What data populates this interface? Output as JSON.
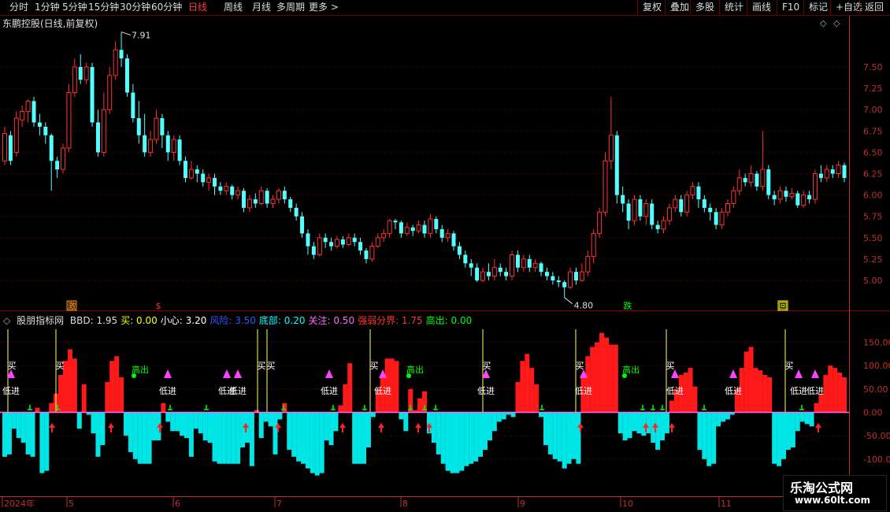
{
  "toolbar": {
    "left_items": [
      "分时",
      "1分钟",
      "5分钟",
      "15分钟",
      "30分钟",
      "60分钟",
      "日线",
      "周线",
      "月线",
      "多周期",
      "更多 >"
    ],
    "active": "日线",
    "right_items": [
      "复权",
      "叠加",
      "多股",
      "统计",
      "画线",
      "F10",
      "标记",
      "+自选",
      "返回"
    ]
  },
  "main_title": "东鹏控股(日线,前复权)",
  "indicator": {
    "name": "股朋指标网",
    "legend": [
      {
        "label": "BBD: 1.95",
        "color": "#dddddd"
      },
      {
        "label": "买: 0.00",
        "color": "#ffff00"
      },
      {
        "label": "小心: 3.20",
        "color": "#ffffff"
      },
      {
        "label": "风险: 3.50",
        "color": "#3355ff"
      },
      {
        "label": "底部: 0.20",
        "color": "#00ffff"
      },
      {
        "label": "关注: 0.50",
        "color": "#ff66ff"
      },
      {
        "label": "强弱分界: 1.75",
        "color": "#ff3333"
      },
      {
        "label": "高出: 0.00",
        "color": "#00ff00"
      }
    ]
  },
  "colors": {
    "up": "#ff3232",
    "down": "#54ffff",
    "grid": "#6b0000",
    "axis": "#c0302a",
    "pos_bar": "#ff1a1a",
    "neg_bar": "#00e5e5"
  },
  "chart_data": [
    {
      "type": "candlestick",
      "title": "东鹏控股(日线,前复权)",
      "y_ticks": [
        5.0,
        5.25,
        5.5,
        5.75,
        6.0,
        6.25,
        6.5,
        6.75,
        7.0,
        7.25,
        7.5
      ],
      "ylim": [
        4.85,
        7.95
      ],
      "annotations": [
        {
          "text": "7.91",
          "kind": "high"
        },
        {
          "text": "4.80",
          "kind": "low"
        }
      ],
      "event_markers": [
        "激",
        "$",
        "跌",
        "回"
      ],
      "candles": [
        {
          "o": 6.4,
          "c": 6.72,
          "h": 6.8,
          "l": 6.35
        },
        {
          "o": 6.7,
          "c": 6.4,
          "h": 6.75,
          "l": 6.35
        },
        {
          "o": 6.5,
          "c": 6.9,
          "h": 6.98,
          "l": 6.45
        },
        {
          "o": 6.88,
          "c": 6.98,
          "h": 7.05,
          "l": 6.8
        },
        {
          "o": 6.98,
          "c": 7.1,
          "h": 7.12,
          "l": 6.85
        },
        {
          "o": 7.1,
          "c": 6.85,
          "h": 7.15,
          "l": 6.8
        },
        {
          "o": 6.85,
          "c": 6.8,
          "h": 6.95,
          "l": 6.7
        },
        {
          "o": 6.8,
          "c": 6.7,
          "h": 6.85,
          "l": 6.6
        },
        {
          "o": 6.7,
          "c": 6.4,
          "h": 6.72,
          "l": 6.05
        },
        {
          "o": 6.4,
          "c": 6.3,
          "h": 6.45,
          "l": 6.2
        },
        {
          "o": 6.3,
          "c": 6.55,
          "h": 6.6,
          "l": 6.25
        },
        {
          "o": 6.55,
          "c": 7.2,
          "h": 7.3,
          "l": 6.5
        },
        {
          "o": 7.2,
          "c": 7.5,
          "h": 7.6,
          "l": 7.15
        },
        {
          "o": 7.5,
          "c": 7.35,
          "h": 7.65,
          "l": 7.3
        },
        {
          "o": 7.35,
          "c": 7.5,
          "h": 7.55,
          "l": 7.3
        },
        {
          "o": 7.5,
          "c": 6.85,
          "h": 7.55,
          "l": 6.8
        },
        {
          "o": 6.85,
          "c": 6.5,
          "h": 7.0,
          "l": 6.45
        },
        {
          "o": 6.5,
          "c": 7.0,
          "h": 7.2,
          "l": 6.45
        },
        {
          "o": 7.0,
          "c": 7.4,
          "h": 7.5,
          "l": 6.95
        },
        {
          "o": 7.4,
          "c": 7.7,
          "h": 7.8,
          "l": 7.35
        },
        {
          "o": 7.7,
          "c": 7.6,
          "h": 7.91,
          "l": 7.5
        },
        {
          "o": 7.6,
          "c": 7.2,
          "h": 7.65,
          "l": 7.15
        },
        {
          "o": 7.2,
          "c": 6.9,
          "h": 7.3,
          "l": 6.85
        },
        {
          "o": 6.9,
          "c": 6.7,
          "h": 7.1,
          "l": 6.6
        },
        {
          "o": 6.7,
          "c": 6.5,
          "h": 6.95,
          "l": 6.45
        },
        {
          "o": 6.5,
          "c": 6.65,
          "h": 6.75,
          "l": 6.45
        },
        {
          "o": 6.65,
          "c": 6.9,
          "h": 7.0,
          "l": 6.6
        },
        {
          "o": 6.9,
          "c": 6.7,
          "h": 6.95,
          "l": 6.55
        },
        {
          "o": 6.7,
          "c": 6.5,
          "h": 6.75,
          "l": 6.4
        },
        {
          "o": 6.5,
          "c": 6.65,
          "h": 6.7,
          "l": 6.4
        },
        {
          "o": 6.65,
          "c": 6.4,
          "h": 6.7,
          "l": 6.35
        },
        {
          "o": 6.4,
          "c": 6.2,
          "h": 6.45,
          "l": 6.15
        },
        {
          "o": 6.2,
          "c": 6.3,
          "h": 6.4,
          "l": 6.18
        },
        {
          "o": 6.3,
          "c": 6.25,
          "h": 6.35,
          "l": 6.15
        },
        {
          "o": 6.25,
          "c": 6.15,
          "h": 6.3,
          "l": 6.1
        },
        {
          "o": 6.15,
          "c": 6.2,
          "h": 6.25,
          "l": 6.05
        },
        {
          "o": 6.2,
          "c": 6.1,
          "h": 6.25,
          "l": 6.0
        },
        {
          "o": 6.1,
          "c": 6.05,
          "h": 6.15,
          "l": 6.0
        },
        {
          "o": 6.05,
          "c": 6.1,
          "h": 6.15,
          "l": 6.0
        },
        {
          "o": 6.1,
          "c": 6.0,
          "h": 6.12,
          "l": 5.95
        },
        {
          "o": 6.0,
          "c": 6.05,
          "h": 6.1,
          "l": 5.95
        },
        {
          "o": 6.05,
          "c": 5.85,
          "h": 6.08,
          "l": 5.8
        },
        {
          "o": 5.85,
          "c": 5.95,
          "h": 6.0,
          "l": 5.8
        },
        {
          "o": 5.95,
          "c": 5.9,
          "h": 6.02,
          "l": 5.85
        },
        {
          "o": 5.9,
          "c": 6.05,
          "h": 6.1,
          "l": 5.88
        },
        {
          "o": 6.05,
          "c": 5.9,
          "h": 6.08,
          "l": 5.85
        },
        {
          "o": 5.9,
          "c": 5.95,
          "h": 6.0,
          "l": 5.85
        },
        {
          "o": 5.95,
          "c": 6.05,
          "h": 6.08,
          "l": 5.9
        },
        {
          "o": 6.05,
          "c": 5.95,
          "h": 6.1,
          "l": 5.9
        },
        {
          "o": 5.95,
          "c": 5.85,
          "h": 5.98,
          "l": 5.8
        },
        {
          "o": 5.85,
          "c": 5.75,
          "h": 5.9,
          "l": 5.7
        },
        {
          "o": 5.75,
          "c": 5.55,
          "h": 5.8,
          "l": 5.5
        },
        {
          "o": 5.55,
          "c": 5.4,
          "h": 5.6,
          "l": 5.3
        },
        {
          "o": 5.4,
          "c": 5.3,
          "h": 5.45,
          "l": 5.25
        },
        {
          "o": 5.3,
          "c": 5.5,
          "h": 5.55,
          "l": 5.28
        },
        {
          "o": 5.5,
          "c": 5.45,
          "h": 5.55,
          "l": 5.38
        },
        {
          "o": 5.45,
          "c": 5.4,
          "h": 5.5,
          "l": 5.35
        },
        {
          "o": 5.4,
          "c": 5.48,
          "h": 5.52,
          "l": 5.38
        },
        {
          "o": 5.48,
          "c": 5.42,
          "h": 5.52,
          "l": 5.38
        },
        {
          "o": 5.42,
          "c": 5.5,
          "h": 5.55,
          "l": 5.4
        },
        {
          "o": 5.5,
          "c": 5.45,
          "h": 5.55,
          "l": 5.4
        },
        {
          "o": 5.45,
          "c": 5.35,
          "h": 5.5,
          "l": 5.3
        },
        {
          "o": 5.35,
          "c": 5.25,
          "h": 5.38,
          "l": 5.2
        },
        {
          "o": 5.25,
          "c": 5.4,
          "h": 5.45,
          "l": 5.22
        },
        {
          "o": 5.4,
          "c": 5.5,
          "h": 5.55,
          "l": 5.38
        },
        {
          "o": 5.5,
          "c": 5.55,
          "h": 5.6,
          "l": 5.45
        },
        {
          "o": 5.55,
          "c": 5.7,
          "h": 5.72,
          "l": 5.5
        },
        {
          "o": 5.7,
          "c": 5.68,
          "h": 5.72,
          "l": 5.6
        },
        {
          "o": 5.68,
          "c": 5.55,
          "h": 5.7,
          "l": 5.5
        },
        {
          "o": 5.55,
          "c": 5.62,
          "h": 5.68,
          "l": 5.52
        },
        {
          "o": 5.62,
          "c": 5.58,
          "h": 5.65,
          "l": 5.52
        },
        {
          "o": 5.58,
          "c": 5.65,
          "h": 5.7,
          "l": 5.55
        },
        {
          "o": 5.65,
          "c": 5.55,
          "h": 5.7,
          "l": 5.5
        },
        {
          "o": 5.55,
          "c": 5.72,
          "h": 5.78,
          "l": 5.5
        },
        {
          "o": 5.72,
          "c": 5.6,
          "h": 5.75,
          "l": 5.55
        },
        {
          "o": 5.6,
          "c": 5.5,
          "h": 5.65,
          "l": 5.45
        },
        {
          "o": 5.5,
          "c": 5.55,
          "h": 5.6,
          "l": 5.45
        },
        {
          "o": 5.55,
          "c": 5.4,
          "h": 5.58,
          "l": 5.35
        },
        {
          "o": 5.4,
          "c": 5.3,
          "h": 5.45,
          "l": 5.25
        },
        {
          "o": 5.3,
          "c": 5.2,
          "h": 5.35,
          "l": 5.15
        },
        {
          "o": 5.2,
          "c": 5.15,
          "h": 5.25,
          "l": 5.05
        },
        {
          "o": 5.15,
          "c": 5.0,
          "h": 5.2,
          "l": 4.98
        },
        {
          "o": 5.0,
          "c": 5.1,
          "h": 5.15,
          "l": 4.98
        },
        {
          "o": 5.1,
          "c": 5.05,
          "h": 5.2,
          "l": 5.0
        },
        {
          "o": 5.05,
          "c": 5.15,
          "h": 5.25,
          "l": 5.0
        },
        {
          "o": 5.15,
          "c": 5.1,
          "h": 5.2,
          "l": 5.05
        },
        {
          "o": 5.1,
          "c": 5.05,
          "h": 5.15,
          "l": 5.0
        },
        {
          "o": 5.05,
          "c": 5.3,
          "h": 5.35,
          "l": 5.0
        },
        {
          "o": 5.3,
          "c": 5.15,
          "h": 5.35,
          "l": 5.1
        },
        {
          "o": 5.15,
          "c": 5.25,
          "h": 5.3,
          "l": 5.1
        },
        {
          "o": 5.25,
          "c": 5.15,
          "h": 5.3,
          "l": 5.1
        },
        {
          "o": 5.15,
          "c": 5.2,
          "h": 5.25,
          "l": 5.1
        },
        {
          "o": 5.2,
          "c": 5.1,
          "h": 5.22,
          "l": 5.05
        },
        {
          "o": 5.1,
          "c": 5.05,
          "h": 5.15,
          "l": 5.0
        },
        {
          "o": 5.05,
          "c": 5.0,
          "h": 5.1,
          "l": 4.95
        },
        {
          "o": 5.0,
          "c": 4.98,
          "h": 5.05,
          "l": 4.92
        },
        {
          "o": 4.98,
          "c": 4.92,
          "h": 5.0,
          "l": 4.8
        },
        {
          "o": 4.92,
          "c": 5.1,
          "h": 5.15,
          "l": 4.9
        },
        {
          "o": 5.1,
          "c": 5.0,
          "h": 5.15,
          "l": 4.95
        },
        {
          "o": 5.0,
          "c": 5.1,
          "h": 5.2,
          "l": 4.98
        },
        {
          "o": 5.1,
          "c": 5.28,
          "h": 5.35,
          "l": 5.05
        },
        {
          "o": 5.28,
          "c": 5.55,
          "h": 5.6,
          "l": 5.2
        },
        {
          "o": 5.55,
          "c": 5.8,
          "h": 5.85,
          "l": 5.5
        },
        {
          "o": 5.8,
          "c": 6.4,
          "h": 6.5,
          "l": 5.75
        },
        {
          "o": 6.4,
          "c": 6.7,
          "h": 7.15,
          "l": 6.3
        },
        {
          "o": 6.7,
          "c": 6.0,
          "h": 6.75,
          "l": 5.9
        },
        {
          "o": 6.0,
          "c": 5.9,
          "h": 6.1,
          "l": 5.8
        },
        {
          "o": 5.9,
          "c": 5.7,
          "h": 5.95,
          "l": 5.6
        },
        {
          "o": 5.7,
          "c": 5.95,
          "h": 6.0,
          "l": 5.65
        },
        {
          "o": 5.95,
          "c": 5.75,
          "h": 6.0,
          "l": 5.7
        },
        {
          "o": 5.75,
          "c": 5.9,
          "h": 5.95,
          "l": 5.65
        },
        {
          "o": 5.9,
          "c": 5.65,
          "h": 5.95,
          "l": 5.6
        },
        {
          "o": 5.65,
          "c": 5.6,
          "h": 5.7,
          "l": 5.55
        },
        {
          "o": 5.6,
          "c": 5.7,
          "h": 5.75,
          "l": 5.55
        },
        {
          "o": 5.7,
          "c": 5.85,
          "h": 5.9,
          "l": 5.65
        },
        {
          "o": 5.85,
          "c": 5.95,
          "h": 6.0,
          "l": 5.8
        },
        {
          "o": 5.95,
          "c": 5.8,
          "h": 6.0,
          "l": 5.75
        },
        {
          "o": 5.8,
          "c": 6.0,
          "h": 6.05,
          "l": 5.75
        },
        {
          "o": 6.0,
          "c": 6.1,
          "h": 6.15,
          "l": 5.95
        },
        {
          "o": 6.1,
          "c": 5.95,
          "h": 6.15,
          "l": 5.85
        },
        {
          "o": 5.95,
          "c": 5.85,
          "h": 6.0,
          "l": 5.8
        },
        {
          "o": 5.85,
          "c": 5.8,
          "h": 5.9,
          "l": 5.7
        },
        {
          "o": 5.8,
          "c": 5.65,
          "h": 5.85,
          "l": 5.6
        },
        {
          "o": 5.65,
          "c": 5.8,
          "h": 5.85,
          "l": 5.6
        },
        {
          "o": 5.8,
          "c": 5.9,
          "h": 5.95,
          "l": 5.75
        },
        {
          "o": 5.9,
          "c": 6.05,
          "h": 6.1,
          "l": 5.85
        },
        {
          "o": 6.05,
          "c": 6.2,
          "h": 6.3,
          "l": 6.0
        },
        {
          "o": 6.2,
          "c": 6.15,
          "h": 6.25,
          "l": 6.1
        },
        {
          "o": 6.15,
          "c": 6.25,
          "h": 6.35,
          "l": 6.1
        },
        {
          "o": 6.25,
          "c": 6.1,
          "h": 6.28,
          "l": 6.05
        },
        {
          "o": 6.1,
          "c": 6.3,
          "h": 6.75,
          "l": 6.05
        },
        {
          "o": 6.3,
          "c": 6.0,
          "h": 6.35,
          "l": 5.95
        },
        {
          "o": 6.0,
          "c": 5.95,
          "h": 6.05,
          "l": 5.88
        },
        {
          "o": 5.95,
          "c": 6.05,
          "h": 6.1,
          "l": 5.9
        },
        {
          "o": 6.05,
          "c": 5.98,
          "h": 6.1,
          "l": 5.92
        },
        {
          "o": 5.98,
          "c": 6.02,
          "h": 6.08,
          "l": 5.95
        },
        {
          "o": 6.02,
          "c": 5.88,
          "h": 6.05,
          "l": 5.85
        },
        {
          "o": 5.88,
          "c": 6.0,
          "h": 6.05,
          "l": 5.85
        },
        {
          "o": 6.0,
          "c": 5.95,
          "h": 6.05,
          "l": 5.9
        },
        {
          "o": 5.95,
          "c": 6.25,
          "h": 6.3,
          "l": 5.9
        },
        {
          "o": 6.25,
          "c": 6.2,
          "h": 6.35,
          "l": 6.15
        },
        {
          "o": 6.2,
          "c": 6.3,
          "h": 6.35,
          "l": 6.15
        },
        {
          "o": 6.3,
          "c": 6.25,
          "h": 6.35,
          "l": 6.2
        },
        {
          "o": 6.25,
          "c": 6.35,
          "h": 6.4,
          "l": 6.2
        },
        {
          "o": 6.35,
          "c": 6.2,
          "h": 6.38,
          "l": 6.15
        }
      ]
    },
    {
      "type": "bar",
      "title": "股朋指标网",
      "y_ticks": [
        150.0,
        100.0,
        50.0,
        0.0,
        -50.0,
        -100.0
      ],
      "ylim": [
        -150,
        150
      ],
      "x_labels": [
        "2024年",
        "5",
        "6",
        "7",
        "8",
        "9",
        "10",
        "11"
      ],
      "signals": [
        "买",
        "低进",
        "高出"
      ],
      "values": [
        -95,
        -90,
        -35,
        -55,
        -65,
        -90,
        -95,
        10,
        -130,
        -125,
        20,
        40,
        80,
        110,
        135,
        115,
        -35,
        60,
        -5,
        -45,
        -95,
        -70,
        65,
        110,
        120,
        75,
        -50,
        -85,
        -100,
        -110,
        -110,
        -110,
        -60,
        -60,
        20,
        -20,
        -40,
        -40,
        -50,
        -55,
        -95,
        -35,
        -45,
        -60,
        -65,
        -105,
        -110,
        -110,
        -110,
        -110,
        -110,
        -75,
        -65,
        -115,
        5,
        -55,
        -20,
        -30,
        -90,
        -15,
        20,
        -80,
        -95,
        -105,
        -110,
        -120,
        -130,
        -135,
        -130,
        -60,
        -70,
        -40,
        15,
        60,
        105,
        -110,
        -110,
        -110,
        -75,
        -10,
        50,
        80,
        115,
        115,
        110,
        -15,
        -40,
        50,
        5,
        30,
        45,
        -45,
        -65,
        -90,
        -110,
        -125,
        -130,
        -130,
        -125,
        -115,
        -110,
        -105,
        -95,
        -80,
        -60,
        -40,
        -20,
        -15,
        -5,
        -10,
        65,
        110,
        125,
        95,
        60,
        -10,
        -70,
        -90,
        -100,
        -105,
        -120,
        -110,
        -100,
        -110,
        80,
        120,
        140,
        150,
        170,
        160,
        145,
        145,
        -45,
        -60,
        -55,
        -40,
        -45,
        -50,
        -45,
        -65,
        -80,
        -60,
        -45,
        25,
        50,
        80,
        85,
        95,
        55,
        -80,
        -100,
        -115,
        -110,
        -30,
        -20,
        -15,
        -5,
        50,
        95,
        130,
        140,
        95,
        90,
        80,
        75,
        -110,
        -115,
        -100,
        -80,
        -75,
        -40,
        -20,
        -25,
        -30,
        20,
        40,
        80,
        100,
        95,
        85,
        75
      ]
    }
  ],
  "watermark": {
    "line1": "乐淘公式网",
    "line2": "www.60lt.com"
  }
}
